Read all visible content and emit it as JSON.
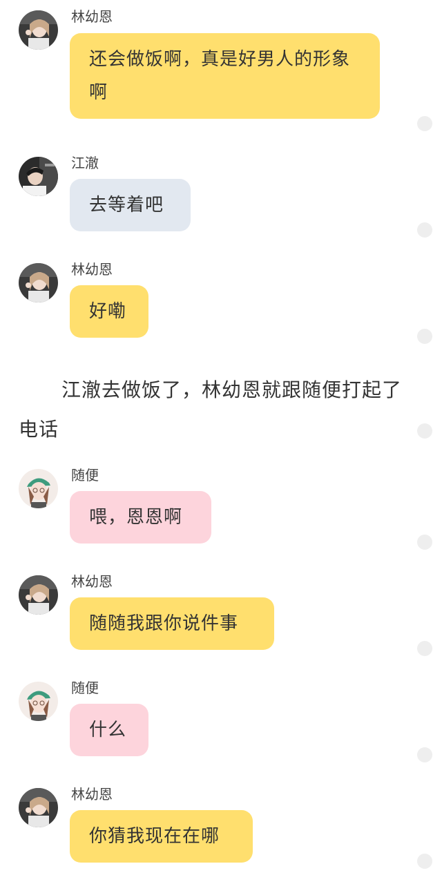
{
  "messages": [
    {
      "sender": "林幼恩",
      "avatar": "avatar-lin",
      "text": "还会做饭啊，真是好男人的形象啊",
      "color": "#ffdf6e"
    },
    {
      "sender": "江澈",
      "avatar": "avatar-jiang",
      "text": "去等着吧",
      "color": "#e2e8f0"
    },
    {
      "sender": "林幼恩",
      "avatar": "avatar-lin",
      "text": "好嘞",
      "color": "#ffdf6e"
    },
    {
      "sender": "随便",
      "avatar": "avatar-suibian",
      "text": "喂，恩恩啊",
      "color": "#fdd4dc"
    },
    {
      "sender": "林幼恩",
      "avatar": "avatar-lin",
      "text": "随随我跟你说件事",
      "color": "#ffdf6e"
    },
    {
      "sender": "随便",
      "avatar": "avatar-suibian",
      "text": "什么",
      "color": "#fdd4dc"
    },
    {
      "sender": "林幼恩",
      "avatar": "avatar-lin",
      "text": "你猜我现在在哪",
      "color": "#ffdf6e"
    }
  ],
  "narration": "江澈去做饭了，林幼恩就跟随便打起了电话"
}
